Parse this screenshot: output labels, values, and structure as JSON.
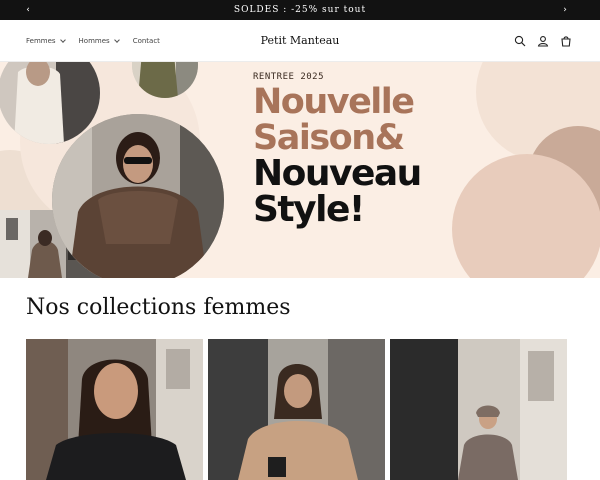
{
  "announcement": {
    "message": "SOLDES : -25% sur tout",
    "prev_icon": "chevron-left-icon",
    "next_icon": "chevron-right-icon"
  },
  "header": {
    "nav": [
      {
        "label": "Femmes",
        "has_dropdown": true
      },
      {
        "label": "Hommes",
        "has_dropdown": true
      },
      {
        "label": "Contact",
        "has_dropdown": false
      }
    ],
    "logo": "Petit Manteau",
    "icons": [
      "search-icon",
      "account-icon",
      "cart-icon"
    ]
  },
  "hero": {
    "eyebrow": "RENTREE 2025",
    "line1": "Nouvelle",
    "line2": "Saison&",
    "line3": "Nouveau",
    "line4": "Style!",
    "colors": {
      "background": "#fbeee4",
      "accent": "#a8745a",
      "dark": "#111111"
    }
  },
  "collections": {
    "title": "Nos collections femmes",
    "cards": [
      {
        "image": "woman-black-leather-jacket-photo"
      },
      {
        "image": "woman-beige-coat-photo"
      },
      {
        "image": "woman-grey-coat-photo"
      }
    ]
  }
}
